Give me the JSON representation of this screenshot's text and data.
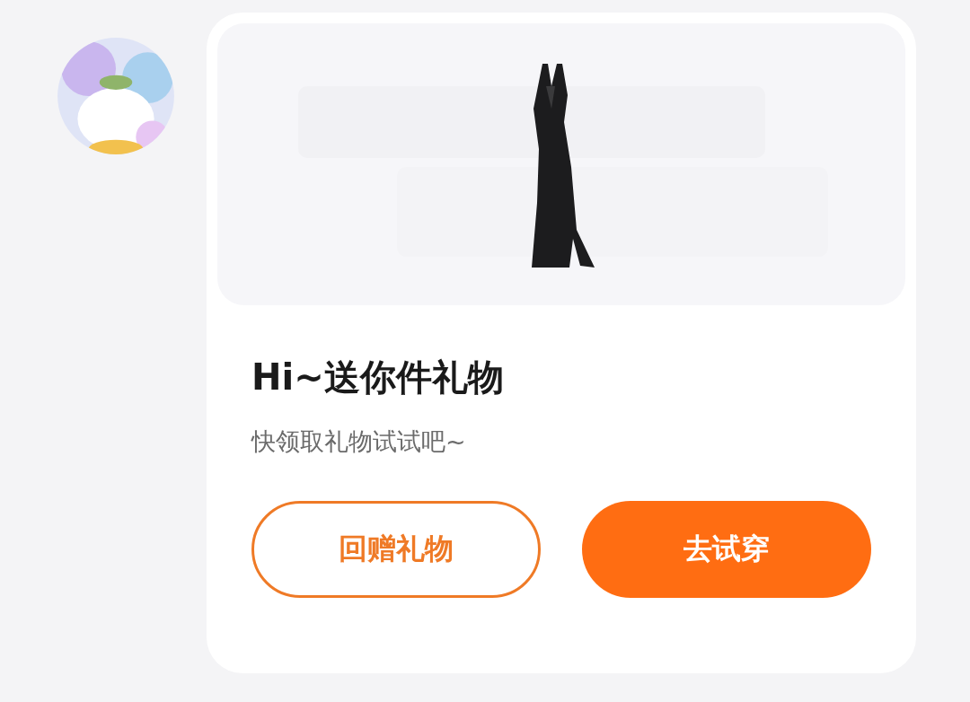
{
  "gift_card": {
    "title": "Hi~送你件礼物",
    "subtitle": "快领取礼物试试吧~",
    "buttons": [
      {
        "label": "回赠礼物",
        "kind": "outline"
      },
      {
        "label": "去试穿",
        "kind": "filled"
      }
    ]
  }
}
